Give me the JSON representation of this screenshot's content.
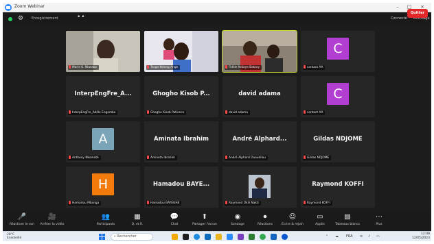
{
  "window": {
    "title": "Zoom Webinar",
    "controls": [
      "–",
      "□",
      "×"
    ]
  },
  "topbar": {
    "view_label": "Enregistrement",
    "right_items": [
      "Connecté",
      "Affichage"
    ]
  },
  "participants": [
    {
      "caption": "Marie K. Nkwabo",
      "kind": "video",
      "active": false
    },
    {
      "caption": "Tsogo-Ndong Ange",
      "kind": "video",
      "active": false
    },
    {
      "caption": "Fidèle Ndiaye Bakary",
      "kind": "video",
      "active": true
    },
    {
      "letter": "C",
      "caption": "contact AA",
      "kind": "avatar",
      "color": "#b23fd1",
      "active": false
    },
    {
      "name": "InterpEngFre_A...",
      "caption": "InterpEngFre_Adèle Engamba",
      "kind": "name",
      "active": false
    },
    {
      "name": "Ghogho Kisob P...",
      "caption": "Ghogho Kisob Patience",
      "kind": "name",
      "active": false
    },
    {
      "name": "david adama",
      "caption": "david adama",
      "kind": "name",
      "active": false
    },
    {
      "letter": "C",
      "caption": "contact AA",
      "kind": "avatar",
      "color": "#b23fd1",
      "active": false
    },
    {
      "letter": "A",
      "caption": "Anthony Nkomaté",
      "kind": "avatar",
      "color": "#7aa4b8",
      "active": false
    },
    {
      "name": "Aminata Ibrahim",
      "caption": "Aminata Ibrahim",
      "kind": "name",
      "active": false
    },
    {
      "name": "André Alphard...",
      "caption": "André Alphard Ououdilou",
      "kind": "name",
      "active": false
    },
    {
      "name": "Gildas NDJOME",
      "caption": "Gildas NDJOME",
      "kind": "name",
      "active": false
    },
    {
      "letter": "H",
      "caption": "Hamadou Mbanga",
      "kind": "avatar",
      "color": "#f27b0c",
      "active": false
    },
    {
      "name": "Hamadou BAYE...",
      "caption": "Hamadou BAYEGHE",
      "kind": "name",
      "active": false
    },
    {
      "caption": "Raymond Okili Nakti",
      "kind": "photo",
      "active": false
    },
    {
      "name": "Raymond KOFFI",
      "caption": "Raymond KOFFI",
      "kind": "name",
      "active": false
    }
  ],
  "toolbar": {
    "buttons": [
      {
        "icon": "🎤",
        "label": "Réactiver le son",
        "icon_name": "microphone-icon"
      },
      {
        "icon": "🎥",
        "label": "Arrêter la vidéo",
        "icon_name": "video-camera-icon"
      },
      {
        "icon": "👥",
        "label": "Participants",
        "icon_name": "participants-icon"
      },
      {
        "icon": "▦",
        "label": "Q. et R.",
        "icon_name": "qa-icon"
      },
      {
        "icon": "💬",
        "label": "Chat",
        "icon_name": "chat-icon"
      },
      {
        "icon": "⬆",
        "label": "Partager l'écran",
        "icon_name": "share-screen-icon"
      },
      {
        "icon": "◉",
        "label": "Sondage",
        "icon_name": "poll-icon"
      },
      {
        "icon": "⏺",
        "label": "Réactions",
        "icon_name": "reactions-icon"
      },
      {
        "icon": "☺",
        "label": "Ecrire & rejoin",
        "icon_name": "whiteboard-icon"
      },
      {
        "icon": "▭",
        "label": "Applis",
        "icon_name": "apps-icon"
      },
      {
        "icon": "▤",
        "label": "Tableaux blancs",
        "icon_name": "whiteboards-icon"
      },
      {
        "icon": "⋯",
        "label": "Plus",
        "icon_name": "more-icon"
      }
    ],
    "leave_label": "Quitter"
  },
  "taskbar": {
    "weather_temp": "28°C",
    "weather_desc": "Ensoleillé",
    "search_placeholder": "Rechercher",
    "tray_lang": "FRA",
    "time": "12:48",
    "date": "12/05/2023"
  },
  "colors": {
    "background": "#1c1c1c",
    "tile": "#262626",
    "active_border": "#c7d833",
    "leave": "#e02828",
    "avatar_purple": "#b23fd1",
    "avatar_orange": "#f27b0c",
    "avatar_slate": "#7aa4b8"
  }
}
